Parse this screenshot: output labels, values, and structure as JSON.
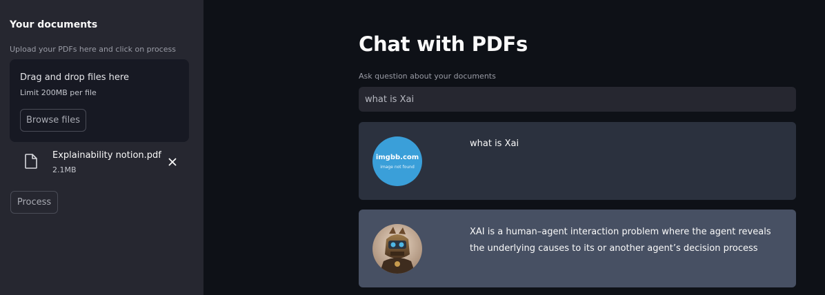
{
  "sidebar": {
    "title": "Your documents",
    "hint": "Upload your PDFs here and click on process",
    "dropzone": {
      "title": "Drag and drop files here",
      "limit": "Limit 200MB per file",
      "browse_label": "Browse files"
    },
    "file": {
      "name": "Explainability notion.pdf",
      "size": "2.1MB"
    },
    "process_label": "Process"
  },
  "main": {
    "title": "Chat with PDFs",
    "question_label": "Ask question about your documents",
    "question_value": "what is Xai",
    "messages": [
      {
        "role": "user",
        "avatar_brand": "imgbb.com",
        "avatar_note": "image not found",
        "text": "what is Xai"
      },
      {
        "role": "bot",
        "text": "XAI is a human–agent interaction problem where the agent reveals the underlying causes to its or another agent’s decision process"
      }
    ]
  },
  "colors": {
    "app_bg": "#0e1117",
    "sidebar_bg": "#262730",
    "user_msg_bg": "#2b313e",
    "bot_msg_bg": "#475063",
    "user_avatar_bg": "#3a9fd9"
  },
  "icons": {
    "file": "file-icon",
    "remove": "close-icon",
    "bot_avatar": "robot-avatar"
  }
}
